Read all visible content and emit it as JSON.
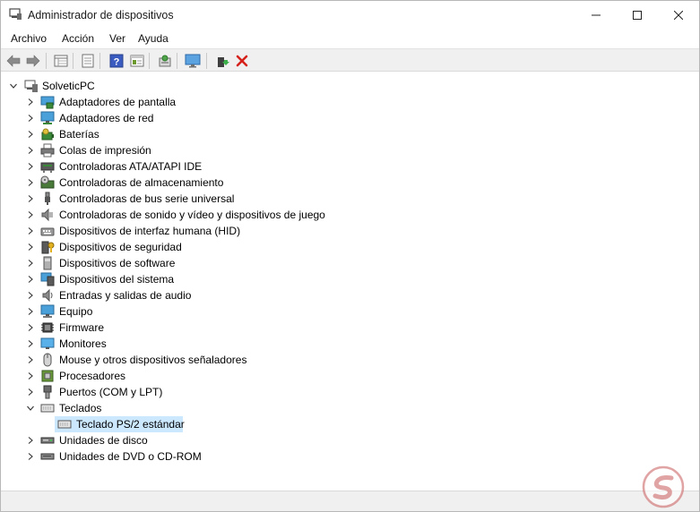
{
  "window": {
    "title": "Administrador de dispositivos",
    "controls": [
      "minimize",
      "maximize",
      "close"
    ]
  },
  "menu": {
    "items": [
      "Archivo",
      "Acción",
      "Ver",
      "Ayuda"
    ]
  },
  "toolbar": {
    "buttons": [
      "back-icon",
      "forward-icon",
      "properties-grid-icon",
      "view-icon",
      "help-icon",
      "console-icon",
      "scan-hardware-icon",
      "monitor-icon",
      "update-driver-icon",
      "uninstall-icon"
    ]
  },
  "tree": {
    "root": "SolveticPC",
    "items": [
      {
        "label": "Adaptadores de pantalla",
        "icon": "display-adapter-icon",
        "expanded": false
      },
      {
        "label": "Adaptadores de red",
        "icon": "network-adapter-icon",
        "expanded": false
      },
      {
        "label": "Baterías",
        "icon": "battery-icon",
        "expanded": false
      },
      {
        "label": "Colas de impresión",
        "icon": "printer-icon",
        "expanded": false
      },
      {
        "label": "Controladoras ATA/ATAPI IDE",
        "icon": "ide-controller-icon",
        "expanded": false
      },
      {
        "label": "Controladoras de almacenamiento",
        "icon": "storage-controller-icon",
        "expanded": false
      },
      {
        "label": "Controladoras de bus serie universal",
        "icon": "usb-icon",
        "expanded": false
      },
      {
        "label": "Controladoras de sonido y vídeo y dispositivos de juego",
        "icon": "sound-icon",
        "expanded": false
      },
      {
        "label": "Dispositivos de interfaz humana (HID)",
        "icon": "hid-icon",
        "expanded": false
      },
      {
        "label": "Dispositivos de seguridad",
        "icon": "security-device-icon",
        "expanded": false
      },
      {
        "label": "Dispositivos de software",
        "icon": "software-device-icon",
        "expanded": false
      },
      {
        "label": "Dispositivos del sistema",
        "icon": "system-device-icon",
        "expanded": false
      },
      {
        "label": "Entradas y salidas de audio",
        "icon": "audio-io-icon",
        "expanded": false
      },
      {
        "label": "Equipo",
        "icon": "computer-icon",
        "expanded": false
      },
      {
        "label": "Firmware",
        "icon": "firmware-icon",
        "expanded": false
      },
      {
        "label": "Monitores",
        "icon": "monitor-icon",
        "expanded": false
      },
      {
        "label": "Mouse y otros dispositivos señaladores",
        "icon": "mouse-icon",
        "expanded": false
      },
      {
        "label": "Procesadores",
        "icon": "processor-icon",
        "expanded": false
      },
      {
        "label": "Puertos (COM y LPT)",
        "icon": "port-icon",
        "expanded": false
      },
      {
        "label": "Teclados",
        "icon": "keyboard-icon",
        "expanded": true,
        "children": [
          {
            "label": "Teclado PS/2 estándar",
            "icon": "keyboard-icon",
            "selected": true
          }
        ]
      },
      {
        "label": "Unidades de disco",
        "icon": "disk-drive-icon",
        "expanded": false
      },
      {
        "label": "Unidades de DVD o CD-ROM",
        "icon": "dvd-drive-icon",
        "expanded": false
      }
    ]
  },
  "colors": {
    "selection": "#cce8ff",
    "toolbar_bg": "#f0f0f0",
    "delete_red": "#d6201a"
  }
}
